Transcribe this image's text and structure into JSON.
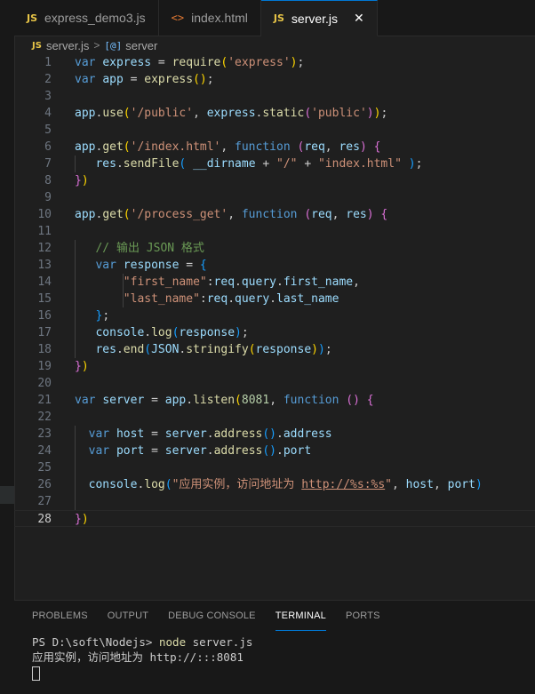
{
  "tabs": [
    {
      "icon": "JS",
      "label": "express_demo3.js",
      "active": false
    },
    {
      "icon": "<>",
      "label": "index.html",
      "active": false
    },
    {
      "icon": "JS",
      "label": "server.js",
      "active": true,
      "close": "✕"
    }
  ],
  "breadcrumb": {
    "file_icon": "JS",
    "file": "server.js",
    "separator": ">",
    "symbol_icon": "[@]",
    "symbol": "server"
  },
  "editor": {
    "line_numbers": [
      "1",
      "2",
      "3",
      "4",
      "5",
      "6",
      "7",
      "8",
      "9",
      "10",
      "11",
      "12",
      "13",
      "14",
      "15",
      "16",
      "17",
      "18",
      "19",
      "20",
      "21",
      "22",
      "23",
      "24",
      "25",
      "26",
      "27",
      "28"
    ],
    "current_line": 28,
    "lines": [
      "var express = require('express');",
      "var app = express();",
      "",
      "app.use('/public', express.static('public'));",
      "",
      "app.get('/index.html', function (req, res) {",
      "   res.sendFile( __dirname + \"/\" + \"index.html\" );",
      "})",
      "",
      "app.get('/process_get', function (req, res) {",
      "",
      "   // 输出 JSON 格式",
      "   var response = {",
      "       \"first_name\":req.query.first_name,",
      "       \"last_name\":req.query.last_name",
      "   };",
      "   console.log(response);",
      "   res.end(JSON.stringify(response));",
      "})",
      "",
      "var server = app.listen(8081, function () {",
      "",
      "  var host = server.address().address",
      "  var port = server.address().port",
      "",
      "  console.log(\"应用实例，访问地址为 http://%s:%s\", host, port)",
      "",
      "})"
    ]
  },
  "panel": {
    "tabs": [
      "PROBLEMS",
      "OUTPUT",
      "DEBUG CONSOLE",
      "TERMINAL",
      "PORTS"
    ],
    "active_tab": "TERMINAL",
    "terminal": {
      "prompt": "PS D:\\soft\\Nodejs> ",
      "command": "node",
      "args": " server.js",
      "output": "应用实例，访问地址为 http://:::8081"
    }
  },
  "colors": {
    "accent": "#0078d4",
    "background": "#1f1f1f",
    "keyword": "#569cd6",
    "string": "#ce9178",
    "function": "#dcdcaa",
    "variable": "#9cdcfe"
  }
}
